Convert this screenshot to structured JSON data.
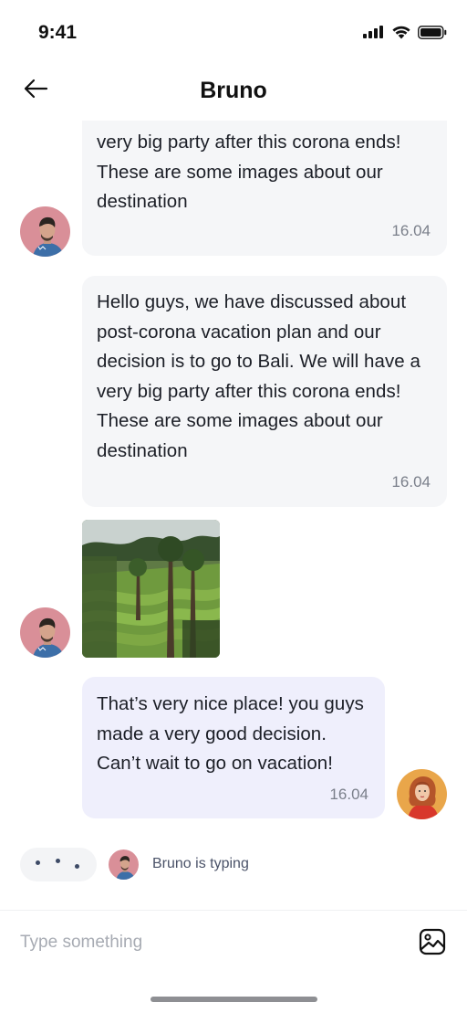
{
  "status_bar": {
    "time": "9:41"
  },
  "header": {
    "title": "Bruno"
  },
  "messages": {
    "msg1": {
      "text": "very big party after this corona ends! These are some images about our destination",
      "time": "16.04"
    },
    "msg2": {
      "text": "Hello guys, we have discussed about post-corona vacation plan and our decision is to go to Bali. We will have a very big party after this corona ends! These are some images about our destination",
      "time": "16.04"
    },
    "msg4": {
      "text": "That’s very nice place! you guys made a very good decision. Can’t wait to go on vacation!",
      "time": "16.04"
    }
  },
  "typing": {
    "text": "Bruno is typing"
  },
  "composer": {
    "placeholder": "Type something"
  },
  "colors": {
    "incoming_bubble": "#f5f6f8",
    "outgoing_bubble": "#efeffc",
    "timestamp": "#7a7f8a",
    "typing_dot": "#3d4a66"
  },
  "icons": {
    "back": "arrow-left-icon",
    "attach_image": "image-icon",
    "signal": "signal-icon",
    "wifi": "wifi-icon",
    "battery": "battery-icon"
  }
}
